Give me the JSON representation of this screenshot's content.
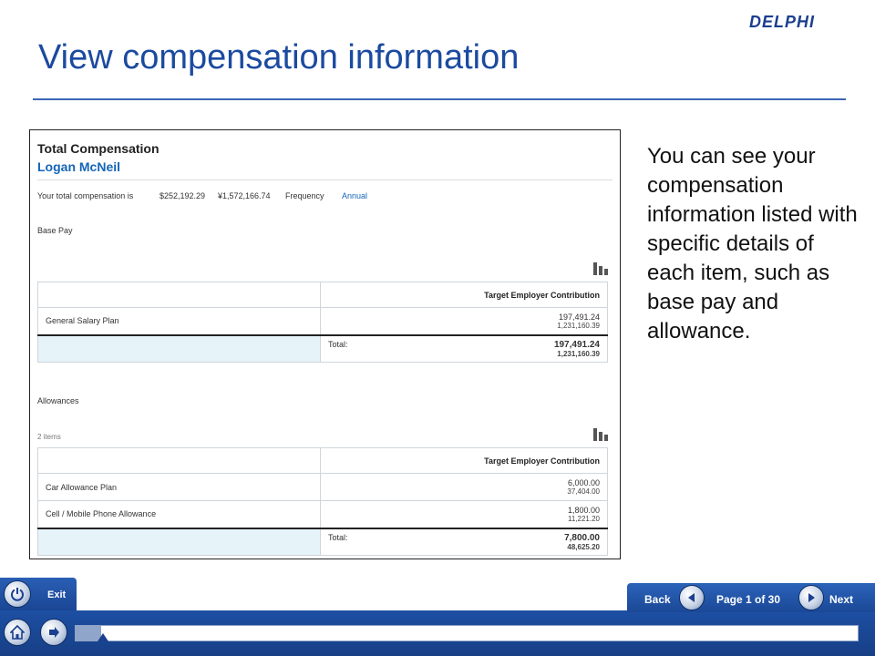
{
  "brand": {
    "logo_text": "DELPHI",
    "primary_color": "#1b4aa0"
  },
  "slide": {
    "title": "View compensation information",
    "description": "You can see your compensation information listed with specific details of each item, such as base pay and allowance."
  },
  "screenshot": {
    "heading": "Total Compensation",
    "employee_name": "Logan McNeil",
    "summary": {
      "label": "Your total compensation is",
      "usd": "$252,192.29",
      "jpy": "¥1,572,166.74",
      "frequency_label": "Frequency",
      "frequency_value": "Annual"
    },
    "base_pay": {
      "heading": "Base Pay",
      "column_header": "Target Employer Contribution",
      "rows": [
        {
          "label": "General Salary Plan",
          "value1": "197,491.24",
          "value2": "1,231,160.39"
        }
      ],
      "total": {
        "label": "Total:",
        "value1": "197,491.24",
        "value2": "1,231,160.39"
      }
    },
    "allowances": {
      "heading": "Allowances",
      "count": "2 items",
      "column_header": "Target Employer Contribution",
      "rows": [
        {
          "label": "Car Allowance Plan",
          "value1": "6,000.00",
          "value2": "37,404.00"
        },
        {
          "label": "Cell / Mobile Phone Allowance",
          "value1": "1,800.00",
          "value2": "11,221.20"
        }
      ],
      "total": {
        "label": "Total:",
        "value1": "7,800.00",
        "value2": "48,625.20"
      }
    }
  },
  "player": {
    "exit_label": "Exit",
    "back_label": "Back",
    "next_label": "Next",
    "page_indicator": "Page 1 of 30",
    "progress_fraction": 0.033,
    "icons": {
      "exit": "power-icon",
      "back": "arrow-left-icon",
      "next": "arrow-right-icon",
      "home": "home-icon",
      "forward": "arrow-right-icon"
    }
  }
}
